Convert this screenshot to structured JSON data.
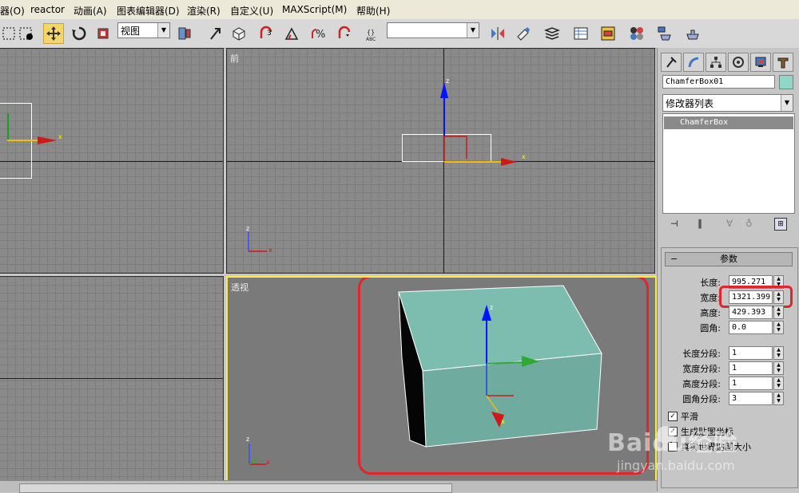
{
  "menu": [
    "器(O)",
    "reactor",
    "动画(A)",
    "图表编辑器(D)",
    "渲染(R)",
    "自定义(U)",
    "MAXScript(M)",
    "帮助(H)"
  ],
  "toolbar": {
    "view_dropdown": "视图",
    "selection_set": ""
  },
  "viewports": {
    "front_label": "前",
    "perspective_label": "透视"
  },
  "axes": {
    "x": "x",
    "y": "y",
    "z": "z"
  },
  "panel": {
    "object_name": "ChamferBox01",
    "object_color": "#8fd8c8",
    "modifier_list": "修改器列表",
    "stack_item": "ChamferBox",
    "rollout_title": "参数",
    "params": [
      {
        "label": "长度:",
        "value": "995.271"
      },
      {
        "label": "宽度:",
        "value": "1321.399"
      },
      {
        "label": "高度:",
        "value": "429.393"
      },
      {
        "label": "圆角:",
        "value": "0.0"
      }
    ],
    "segments": [
      {
        "label": "长度分段:",
        "value": "1"
      },
      {
        "label": "宽度分段:",
        "value": "1"
      },
      {
        "label": "高度分段:",
        "value": "1"
      },
      {
        "label": "圆角分段:",
        "value": "3"
      }
    ],
    "smooth_label": "平滑",
    "gen_mapping_label": "生成贴图坐标",
    "real_world_label": "真实世界贴图大小"
  },
  "watermark": {
    "brand": "Baidu经验",
    "url": "jingyan.baidu.com"
  },
  "colors": {
    "highlight": "#e0252c",
    "active_viewport": "#ffeb3b",
    "box": "#79b5a8"
  }
}
